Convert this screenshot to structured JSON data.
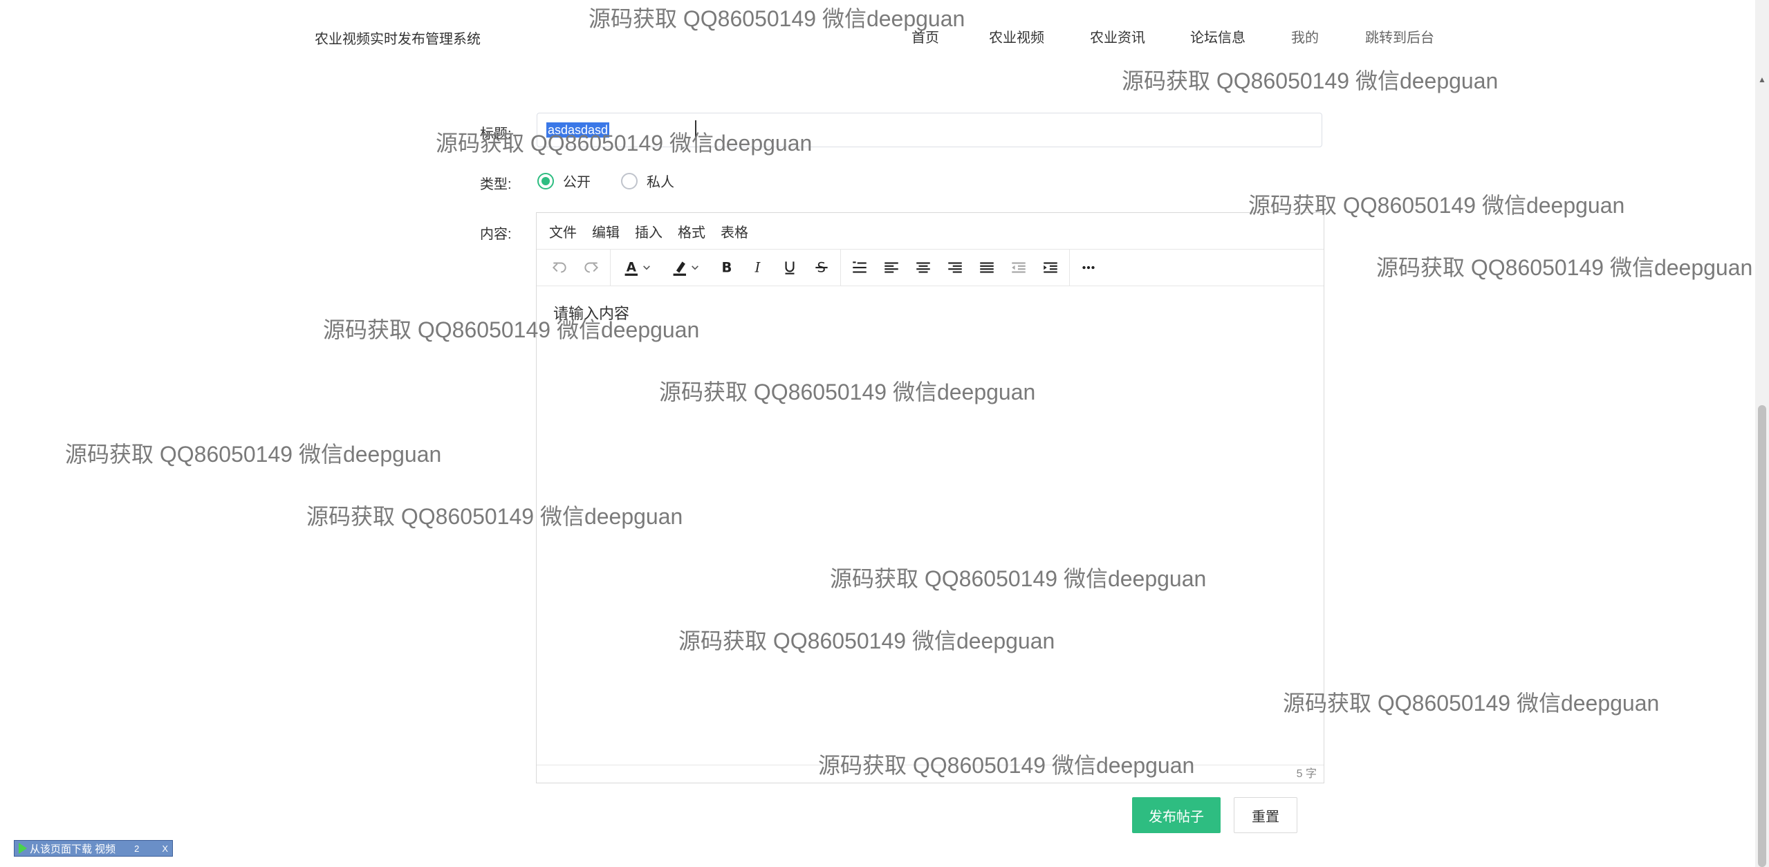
{
  "header": {
    "site_title": "农业视频实时发布管理系统",
    "nav": [
      "首页",
      "农业视频",
      "农业资讯",
      "论坛信息",
      "我的",
      "跳转到后台"
    ]
  },
  "form": {
    "title_label": "标题:",
    "title_value": "asdasdasd",
    "type_label": "类型:",
    "type_options": [
      "公开",
      "私人"
    ],
    "type_selected": "公开",
    "content_label": "内容:"
  },
  "editor": {
    "menu": [
      "文件",
      "编辑",
      "插入",
      "格式",
      "表格"
    ],
    "placeholder": "请输入内容",
    "word_count": "5 字"
  },
  "buttons": {
    "submit": "发布帖子",
    "reset": "重置"
  },
  "download_bar": {
    "label": "从该页面下载 视频",
    "count": "2",
    "close": "X"
  },
  "watermark": "源码获取 QQ86050149 微信deepguan",
  "colors": {
    "primary": "#2ebd81",
    "selection": "#3b78e7"
  }
}
